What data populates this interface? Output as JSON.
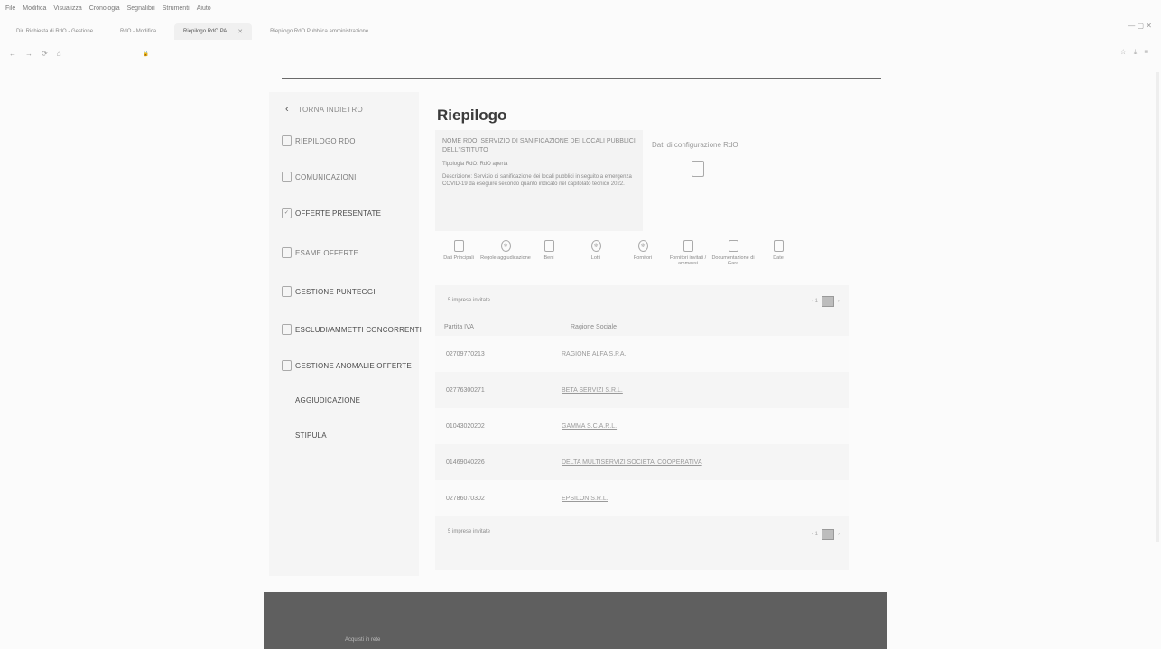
{
  "browser": {
    "menu": [
      "File",
      "Modifica",
      "Visualizza",
      "Cronologia",
      "Segnalibri",
      "Strumenti",
      "Aiuto"
    ],
    "tabs": [
      {
        "label": "Dir. Richiesta di RdO - Gestione"
      },
      {
        "label": "RdO - Modifica"
      },
      {
        "label": "Riepilogo RdO PA"
      },
      {
        "label": "Riepilogo RdO Pubblica amministrazione"
      }
    ],
    "window_controls": "—   ▢   ✕"
  },
  "sidebar": {
    "back": "TORNA INDIETRO",
    "items": [
      {
        "label": "RIEPILOGO RDO",
        "icon": "document-icon"
      },
      {
        "label": "COMUNICAZIONI",
        "icon": "chat-icon"
      },
      {
        "label": "OFFERTE PRESENTATE",
        "icon": "offer-icon"
      },
      {
        "label": "ESAME OFFERTE",
        "icon": "document-icon"
      },
      {
        "label": "GESTIONE PUNTEGGI",
        "icon": "score-icon"
      },
      {
        "label": "ESCLUDI/AMMETTI CONCORRENTI",
        "icon": "user-icon"
      },
      {
        "label": "GESTIONE ANOMALIE OFFERTE",
        "icon": "warning-icon"
      },
      {
        "label": "AGGIUDICAZIONE",
        "icon": "award-icon"
      },
      {
        "label": "STIPULA",
        "icon": "sign-icon"
      }
    ]
  },
  "main": {
    "title": "Riepilogo",
    "info": {
      "heading": "NOME RDO: SERVIZIO DI SANIFICAZIONE DEI LOCALI PUBBLICI DELL'ISTITUTO",
      "type": "Tipologia RdO: RdO aperta",
      "description": "Descrizione: Servizio di sanificazione dei locali pubblici in seguito a emergenza COVID-19 da eseguire secondo quanto indicato nel capitolato tecnico 2022."
    },
    "config_label": "Dati di configurazione RdO",
    "actions": [
      {
        "label": "Dati Principali",
        "icon": "document-icon"
      },
      {
        "label": "Regole aggiudicazione",
        "icon": "gear-icon"
      },
      {
        "label": "Beni",
        "icon": "box-icon"
      },
      {
        "label": "Lotti",
        "icon": "gear-icon"
      },
      {
        "label": "Fornitori",
        "icon": "users-icon"
      },
      {
        "label": "Fornitori invitati / ammessi",
        "icon": "list-icon"
      },
      {
        "label": "Documentazione di Gara",
        "icon": "document-icon"
      },
      {
        "label": "Date",
        "icon": "calendar-icon"
      }
    ],
    "table": {
      "invited_count": "5 imprese invitate",
      "pager_prev": "‹ 1",
      "pager_next": "›",
      "col_piva": "Partita IVA",
      "col_ragione": "Ragione Sociale",
      "rows": [
        {
          "piva": "02709770213",
          "ragione": "RAGIONE ALFA S.P.A."
        },
        {
          "piva": "02776300271",
          "ragione": "BETA SERVIZI S.R.L."
        },
        {
          "piva": "01043020202",
          "ragione": "GAMMA S.C.A.R.L."
        },
        {
          "piva": "01469040226",
          "ragione": "DELTA MULTISERVIZI SOCIETA' COOPERATIVA"
        },
        {
          "piva": "02786070302",
          "ragione": "EPSILON S.R.L."
        }
      ]
    }
  },
  "footer": {
    "text": "Acquisti in rete"
  }
}
